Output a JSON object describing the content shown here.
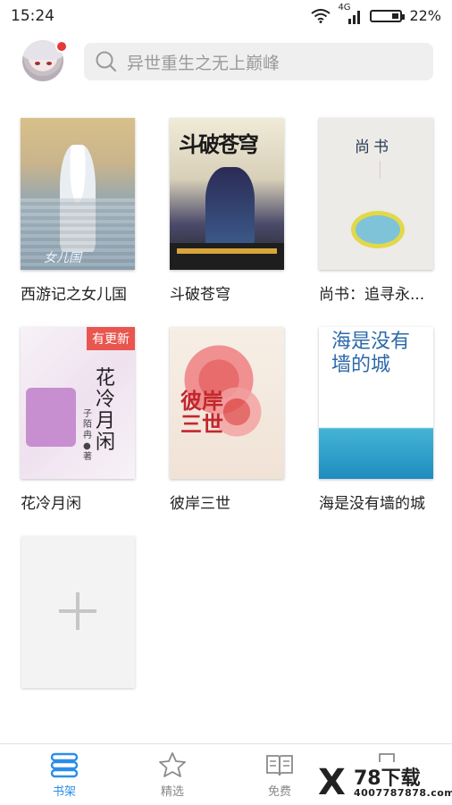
{
  "status_bar": {
    "time": "15:24",
    "network": "4G",
    "battery": "22%"
  },
  "header": {
    "search_placeholder": "异世重生之无上巅峰"
  },
  "books": [
    {
      "title": "西游记之女儿国",
      "cover_text": "女儿国",
      "badge": ""
    },
    {
      "title": "斗破苍穹",
      "cover_text": "斗破苍穹",
      "badge": ""
    },
    {
      "title": "尚书：追寻永...",
      "cover_text": "尚书",
      "badge": ""
    },
    {
      "title": "花冷月闲",
      "cover_text": "花冷月闲",
      "cover_author": "子陌冉●著",
      "badge": "有更新"
    },
    {
      "title": "彼岸三世",
      "cover_text": "彼岸三世",
      "badge": ""
    },
    {
      "title": "海是没有墙的城",
      "cover_text": "海是没有墙的城",
      "badge": ""
    }
  ],
  "tabs": [
    {
      "label": "书架",
      "icon": "bookshelf-icon",
      "active": true
    },
    {
      "label": "精选",
      "icon": "star-icon",
      "active": false
    },
    {
      "label": "免费",
      "icon": "open-book-icon",
      "active": false
    },
    {
      "label": "",
      "icon": "book-icon",
      "active": false
    }
  ],
  "watermark": {
    "mark": "X",
    "title": "78下载",
    "url": "4007787878.com"
  },
  "colors": {
    "accent": "#2a8ee8",
    "badge": "#e8564f",
    "search_bg": "#efefef"
  }
}
